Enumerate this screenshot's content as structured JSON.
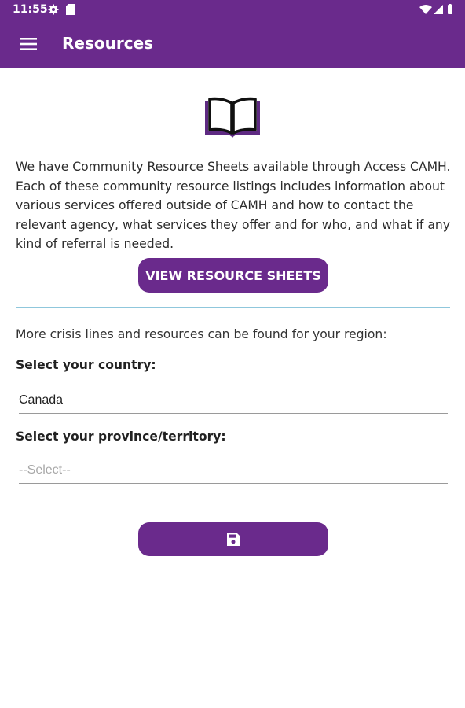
{
  "status_bar": {
    "time": "11:55",
    "icons": [
      "gear-icon",
      "sd-card-icon",
      "wifi-icon",
      "signal-icon",
      "battery-icon"
    ]
  },
  "app_bar": {
    "title": "Resources",
    "menu_icon": "hamburger-menu-icon",
    "color": "#6a2a8c"
  },
  "main": {
    "header_icon": "open-book-icon",
    "intro_text": "We have Community Resource Sheets available through Access CAMH.  Each of these community resource listings includes information about various services offered outside of CAMH and how to contact the relevant agency, what services they offer and for who, and what if any kind of referral is needed.",
    "view_button_label": "VIEW RESOURCE SHEETS",
    "crisis_text": "More crisis lines and resources can be found for your region:",
    "country": {
      "label": "Select your country:",
      "value": "Canada"
    },
    "province": {
      "label": "Select your province/territory:",
      "placeholder": "--Select--"
    },
    "save_icon": "save-icon",
    "divider_color": "#8fc7dc"
  }
}
